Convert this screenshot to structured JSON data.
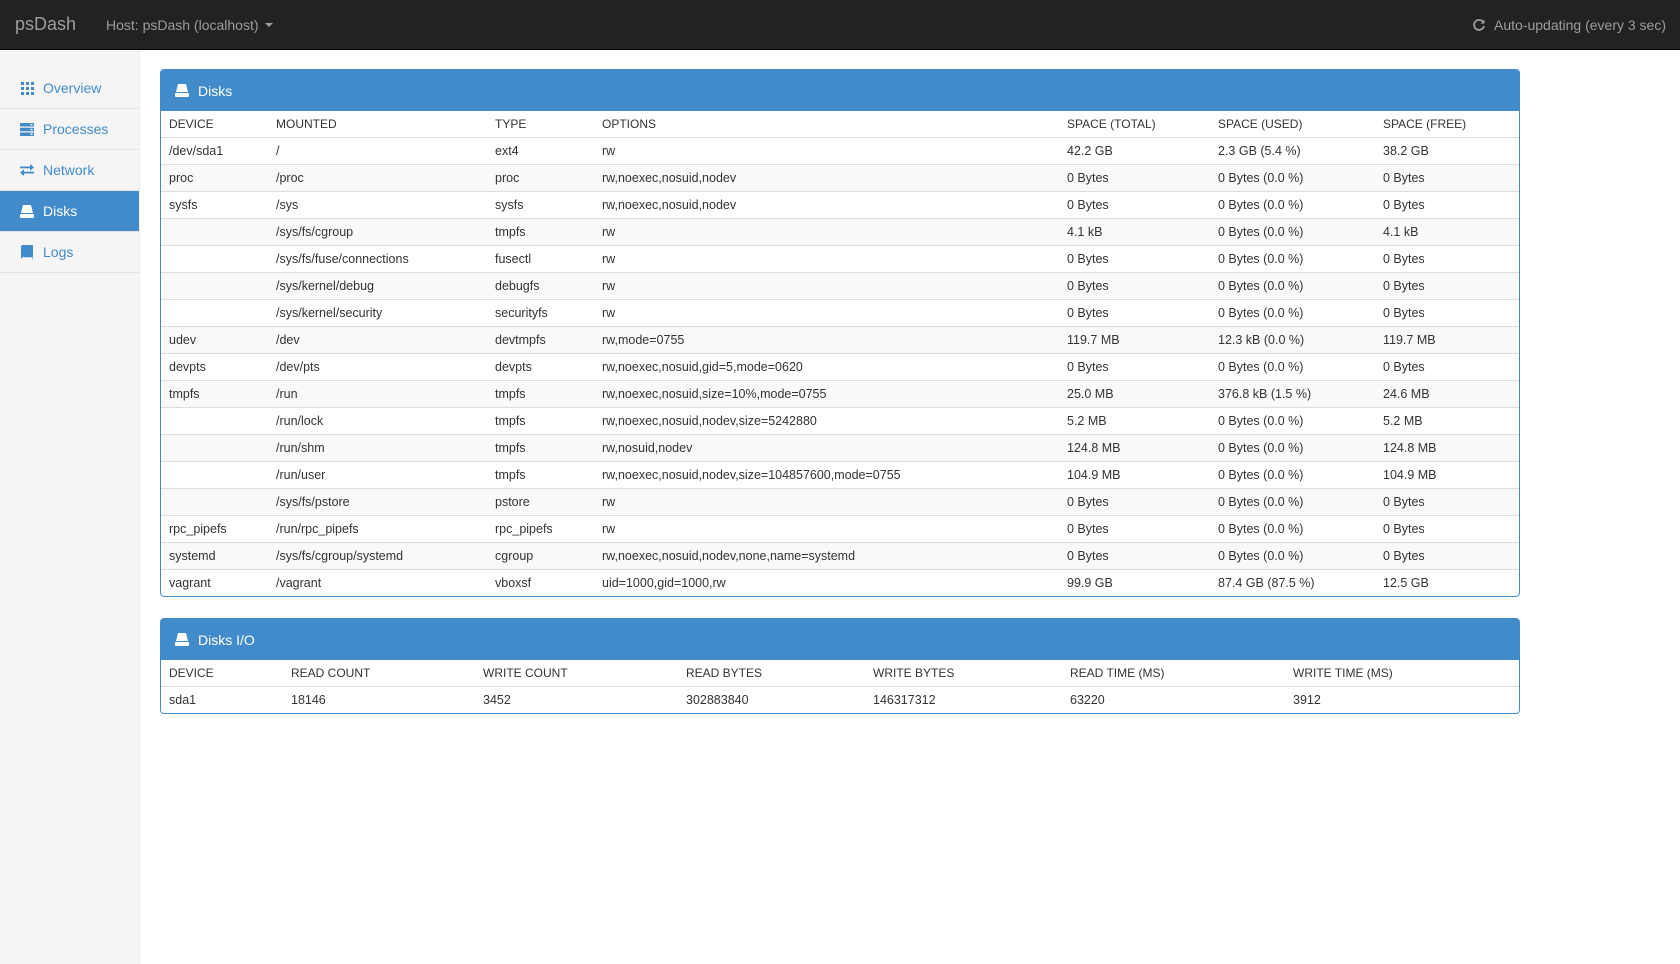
{
  "navbar": {
    "brand": "psDash",
    "host_label": "Host: psDash (localhost)",
    "auto_update": "Auto-updating (every 3 sec)"
  },
  "sidebar": {
    "items": [
      {
        "label": "Overview",
        "icon": "grid-icon",
        "active": false
      },
      {
        "label": "Processes",
        "icon": "server-icon",
        "active": false
      },
      {
        "label": "Network",
        "icon": "transfer-icon",
        "active": false
      },
      {
        "label": "Disks",
        "icon": "hdd-icon",
        "active": true
      },
      {
        "label": "Logs",
        "icon": "book-icon",
        "active": false
      }
    ]
  },
  "disks": {
    "title": "Disks",
    "columns": [
      "DEVICE",
      "MOUNTED",
      "TYPE",
      "OPTIONS",
      "SPACE (TOTAL)",
      "SPACE (USED)",
      "SPACE (FREE)"
    ],
    "rows": [
      [
        "/dev/sda1",
        "/",
        "ext4",
        "rw",
        "42.2 GB",
        "2.3 GB (5.4 %)",
        "38.2 GB"
      ],
      [
        "proc",
        "/proc",
        "proc",
        "rw,noexec,nosuid,nodev",
        "0 Bytes",
        "0 Bytes (0.0 %)",
        "0 Bytes"
      ],
      [
        "sysfs",
        "/sys",
        "sysfs",
        "rw,noexec,nosuid,nodev",
        "0 Bytes",
        "0 Bytes (0.0 %)",
        "0 Bytes"
      ],
      [
        "",
        "/sys/fs/cgroup",
        "tmpfs",
        "rw",
        "4.1 kB",
        "0 Bytes (0.0 %)",
        "4.1 kB"
      ],
      [
        "",
        "/sys/fs/fuse/connections",
        "fusectl",
        "rw",
        "0 Bytes",
        "0 Bytes (0.0 %)",
        "0 Bytes"
      ],
      [
        "",
        "/sys/kernel/debug",
        "debugfs",
        "rw",
        "0 Bytes",
        "0 Bytes (0.0 %)",
        "0 Bytes"
      ],
      [
        "",
        "/sys/kernel/security",
        "securityfs",
        "rw",
        "0 Bytes",
        "0 Bytes (0.0 %)",
        "0 Bytes"
      ],
      [
        "udev",
        "/dev",
        "devtmpfs",
        "rw,mode=0755",
        "119.7 MB",
        "12.3 kB (0.0 %)",
        "119.7 MB"
      ],
      [
        "devpts",
        "/dev/pts",
        "devpts",
        "rw,noexec,nosuid,gid=5,mode=0620",
        "0 Bytes",
        "0 Bytes (0.0 %)",
        "0 Bytes"
      ],
      [
        "tmpfs",
        "/run",
        "tmpfs",
        "rw,noexec,nosuid,size=10%,mode=0755",
        "25.0 MB",
        "376.8 kB (1.5 %)",
        "24.6 MB"
      ],
      [
        "",
        "/run/lock",
        "tmpfs",
        "rw,noexec,nosuid,nodev,size=5242880",
        "5.2 MB",
        "0 Bytes (0.0 %)",
        "5.2 MB"
      ],
      [
        "",
        "/run/shm",
        "tmpfs",
        "rw,nosuid,nodev",
        "124.8 MB",
        "0 Bytes (0.0 %)",
        "124.8 MB"
      ],
      [
        "",
        "/run/user",
        "tmpfs",
        "rw,noexec,nosuid,nodev,size=104857600,mode=0755",
        "104.9 MB",
        "0 Bytes (0.0 %)",
        "104.9 MB"
      ],
      [
        "",
        "/sys/fs/pstore",
        "pstore",
        "rw",
        "0 Bytes",
        "0 Bytes (0.0 %)",
        "0 Bytes"
      ],
      [
        "rpc_pipefs",
        "/run/rpc_pipefs",
        "rpc_pipefs",
        "rw",
        "0 Bytes",
        "0 Bytes (0.0 %)",
        "0 Bytes"
      ],
      [
        "systemd",
        "/sys/fs/cgroup/systemd",
        "cgroup",
        "rw,noexec,nosuid,nodev,none,name=systemd",
        "0 Bytes",
        "0 Bytes (0.0 %)",
        "0 Bytes"
      ],
      [
        "vagrant",
        "/vagrant",
        "vboxsf",
        "uid=1000,gid=1000,rw",
        "99.9 GB",
        "87.4 GB (87.5 %)",
        "12.5 GB"
      ]
    ]
  },
  "disks_io": {
    "title": "Disks I/O",
    "columns": [
      "DEVICE",
      "READ COUNT",
      "WRITE COUNT",
      "READ BYTES",
      "WRITE BYTES",
      "READ TIME (MS)",
      "WRITE TIME (MS)"
    ],
    "rows": [
      [
        "sda1",
        "18146",
        "3452",
        "302883840",
        "146317312",
        "63220",
        "3912"
      ]
    ]
  }
}
